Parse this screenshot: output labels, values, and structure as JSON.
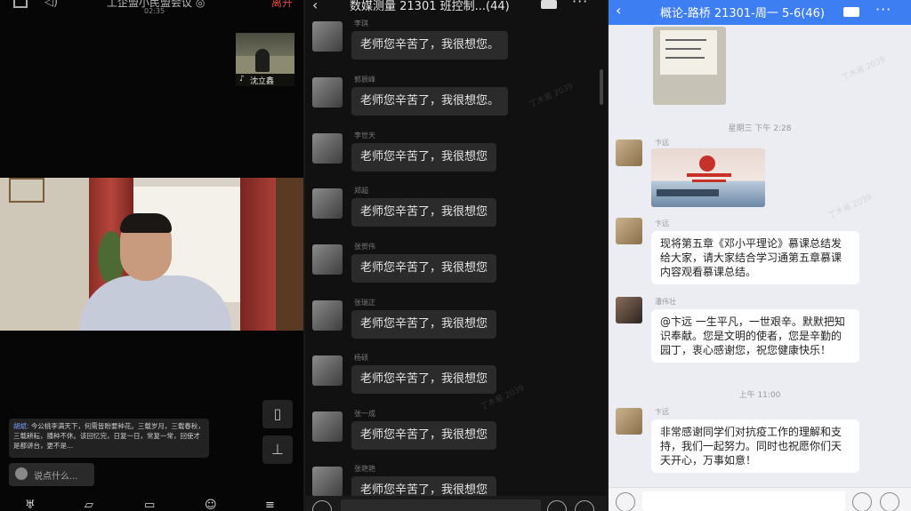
{
  "meeting": {
    "title": "工企盟小民盟会议 ◎",
    "time": "02:35",
    "leave_label": "离开",
    "participant_name": "沈立鑫",
    "chat_sender": "胡斌:",
    "chat_text": "今公桃李满天下，何需皆盼要种花。三载岁月，三载春秋，三载耕耘，播种不休。该回忆完，日复一日，常复一常，回使才是都讲台，更不是...",
    "input_placeholder": "说点什么...",
    "icons": {
      "screen": "screen-share-icon",
      "speaker": "speaker-icon",
      "phone": "phone-rotate-icon",
      "pin": "pin-icon",
      "bottom": [
        "mic-muted-icon",
        "video-off-icon",
        "share-screen-icon",
        "participants-icon",
        "menu-icon"
      ]
    }
  },
  "dark_chat": {
    "title": "数媒测量 21301 班控制...(44)",
    "watermarks": [
      "丁木易 2039",
      "丁木易 2039"
    ],
    "messages": [
      {
        "sender": "李琪",
        "text": "老师您辛苦了，我很想您。"
      },
      {
        "sender": "郭辰峰",
        "text": "老师您辛苦了，我很想您。"
      },
      {
        "sender": "李世天",
        "text": "老师您辛苦了，我很想您"
      },
      {
        "sender": "郑超",
        "text": "老师您辛苦了，我很想您"
      },
      {
        "sender": "张贺伟",
        "text": "老师您辛苦了，我很想您"
      },
      {
        "sender": "张瑞正",
        "text": "老师您辛苦了，我很想您"
      },
      {
        "sender": "杨硕",
        "text": "老师您辛苦了，我很想您"
      },
      {
        "sender": "张一成",
        "text": "老师您辛苦了，我很想您"
      },
      {
        "sender": "张艳艳",
        "text": "老师您辛苦了，我很想您"
      }
    ]
  },
  "light_chat": {
    "title": "概论-路桥 21301-周一 5-6(46)",
    "time_label_1": "星期三 下午 2:28",
    "time_label_2": "上午 11:00",
    "watermarks": [
      "丁木易 2039",
      "丁木易 2039"
    ],
    "sender_a": "卞远",
    "sender_b": "潘伟壮",
    "msg_1": "现将第五章《邓小平理论》慕课总结发给大家，请大家结合学习通第五章慕课内容观看慕课总结。",
    "msg_2": "@卞远 一生平凡，一世艰辛。默默把知识奉献。您是文明的使者，您是辛勤的园丁，衷心感谢您，祝您健康快乐！",
    "msg_3": "非常感谢同学们对抗疫工作的理解和支持，我们一起努力。同时也祝愿你们天天开心，万事如意！"
  }
}
